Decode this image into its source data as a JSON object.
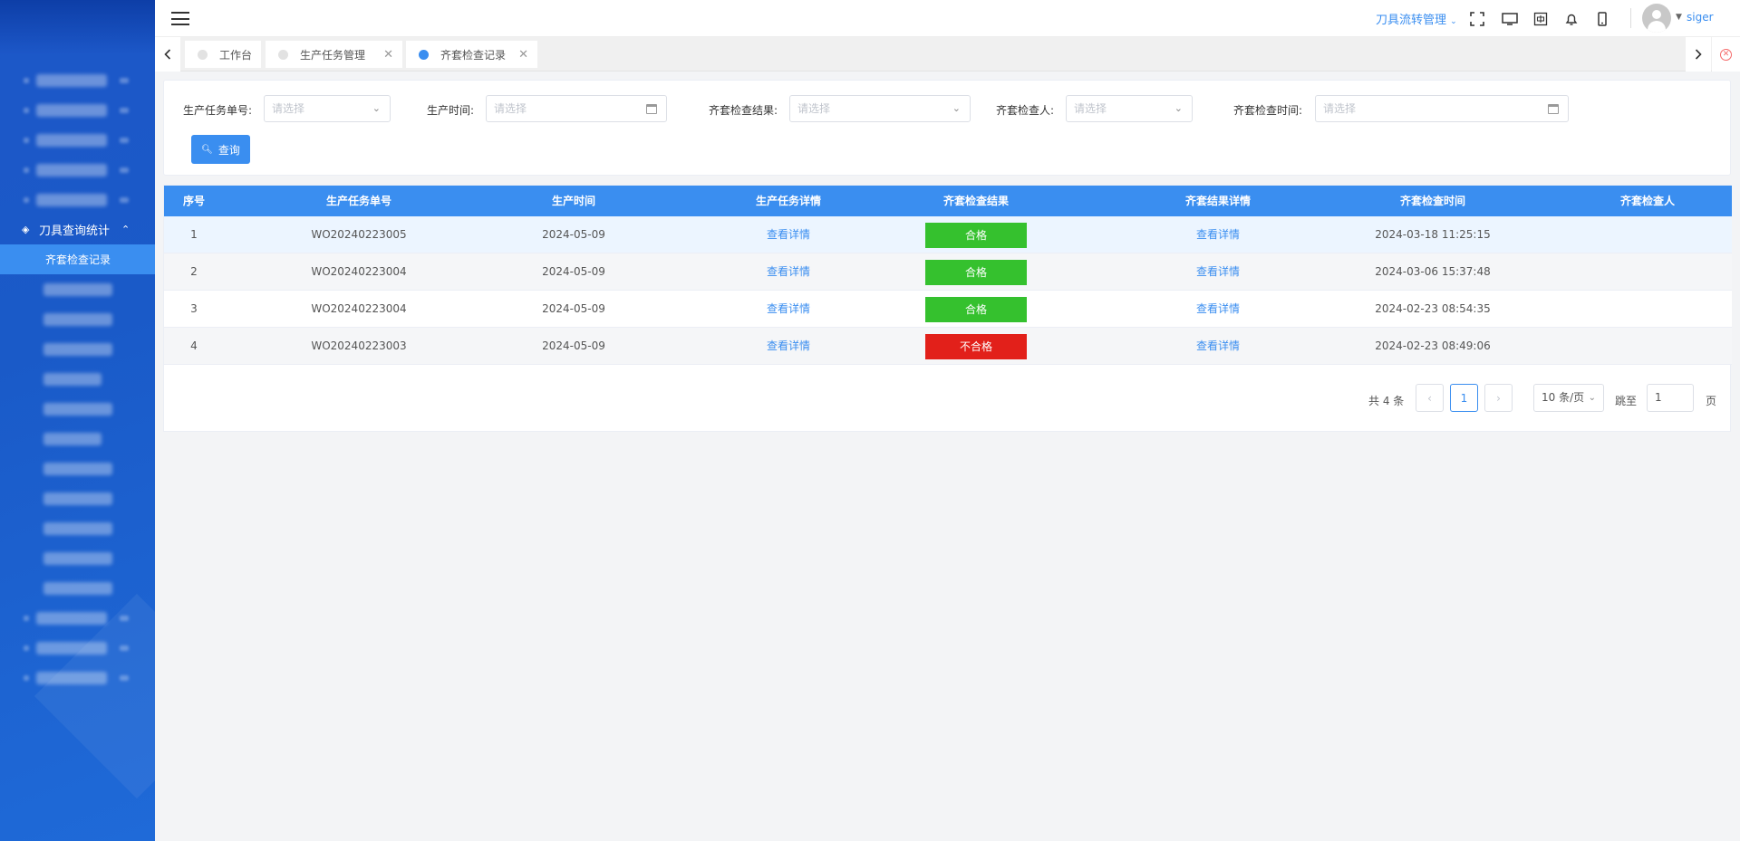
{
  "sidebar": {
    "group_label": "刀具查询统计",
    "active_item": "齐套检查记录"
  },
  "header": {
    "module": "刀具流转管理",
    "user": "siger",
    "icons": [
      "menu-icon",
      "fullscreen-icon",
      "monitor-icon",
      "language-icon",
      "bell-icon",
      "mobile-icon"
    ]
  },
  "tabs": [
    {
      "label": "工作台"
    },
    {
      "label": "生产任务管理"
    },
    {
      "label": "齐套检查记录"
    }
  ],
  "filters": {
    "task_no_label": "生产任务单号:",
    "task_no_placeholder": "请选择",
    "prod_time_label": "生产时间:",
    "prod_time_placeholder": "请选择",
    "result_label": "齐套检查结果:",
    "result_placeholder": "请选择",
    "inspector_label": "齐套检查人:",
    "inspector_placeholder": "请选择",
    "check_time_label": "齐套检查时间:",
    "check_time_placeholder": "请选择",
    "query_button": "查询"
  },
  "table": {
    "columns": [
      "序号",
      "生产任务单号",
      "生产时间",
      "生产任务详情",
      "齐套检查结果",
      "齐套结果详情",
      "齐套检查时间",
      "齐套检查人"
    ],
    "rows": [
      {
        "idx": "1",
        "task_no": "WO20240223005",
        "prod_time": "2024-05-09",
        "detail": "查看详情",
        "result": "合格",
        "result_detail": "查看详情",
        "check_time": "2024-03-18 11:25:15",
        "inspector": ""
      },
      {
        "idx": "2",
        "task_no": "WO20240223004",
        "prod_time": "2024-05-09",
        "detail": "查看详情",
        "result": "合格",
        "result_detail": "查看详情",
        "check_time": "2024-03-06 15:37:48",
        "inspector": ""
      },
      {
        "idx": "3",
        "task_no": "WO20240223004",
        "prod_time": "2024-05-09",
        "detail": "查看详情",
        "result": "合格",
        "result_detail": "查看详情",
        "check_time": "2024-02-23 08:54:35",
        "inspector": ""
      },
      {
        "idx": "4",
        "task_no": "WO20240223003",
        "prod_time": "2024-05-09",
        "detail": "查看详情",
        "result": "不合格",
        "result_detail": "查看详情",
        "check_time": "2024-02-23 08:49:06",
        "inspector": ""
      }
    ]
  },
  "pagination": {
    "total": "共 4 条",
    "current_page": "1",
    "page_size": "10 条/页",
    "goto_label": "跳至",
    "goto_value": "1",
    "page_suffix": "页"
  },
  "colors": {
    "primary": "#3a8ef0",
    "pass": "#35c12e",
    "fail": "#e2201a",
    "sidebar": "#1d57c8"
  }
}
